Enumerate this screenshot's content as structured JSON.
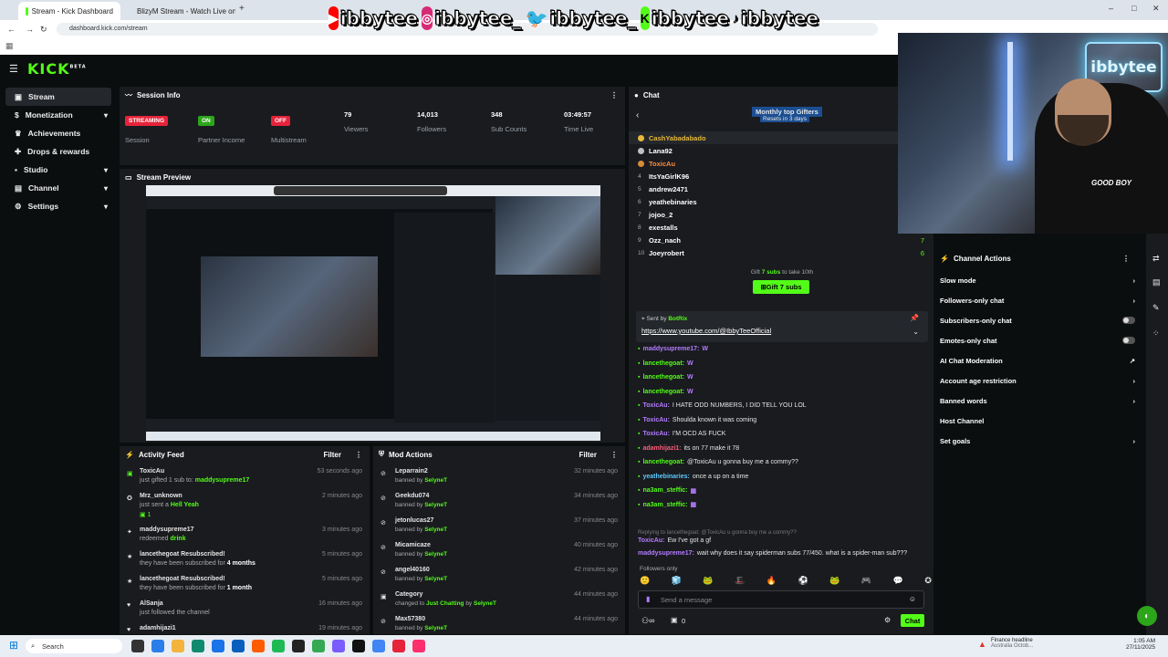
{
  "browser": {
    "tabs": [
      {
        "label": "Stream - Kick Dashboard"
      },
      {
        "label": "BlizyM Stream - Watch Live on..."
      }
    ],
    "new_tab": "+",
    "url": "dashboard.kick.com/stream"
  },
  "banner": {
    "handles": [
      "ibbytee",
      "ibbytee_",
      "ibbytee_",
      "ibbytee",
      "ibbytee"
    ]
  },
  "app": {
    "logo": "KICK",
    "logo_sup": "BETA"
  },
  "sidebar": {
    "items": [
      {
        "label": "Stream",
        "icon": "stream-icon"
      },
      {
        "label": "Monetization",
        "icon": "dollar-icon",
        "chev": "▾"
      },
      {
        "label": "Achievements",
        "icon": "trophy-icon"
      },
      {
        "label": "Drops & rewards",
        "icon": "gift-icon"
      },
      {
        "label": "Studio",
        "icon": "camera-icon",
        "chev": "▾"
      },
      {
        "label": "Channel",
        "icon": "channel-icon",
        "chev": "▾"
      },
      {
        "label": "Settings",
        "icon": "gear-icon",
        "chev": "▾"
      }
    ]
  },
  "session": {
    "title": "Session Info",
    "stats": [
      {
        "value": "STREAMING",
        "label": "Session",
        "color": "#e5233a"
      },
      {
        "value": "ON",
        "label": "Partner Income",
        "color": "#2ca51b"
      },
      {
        "value": "OFF",
        "label": "Multistream",
        "color": "#e5233a"
      },
      {
        "value": "79",
        "label": "Viewers"
      },
      {
        "value": "14,013",
        "label": "Followers"
      },
      {
        "value": "348",
        "label": "Sub Counts"
      },
      {
        "value": "03:49:57",
        "label": "Time Live"
      }
    ]
  },
  "preview": {
    "title": "Stream Preview"
  },
  "activity": {
    "title": "Activity Feed",
    "filter": "Filter",
    "items": [
      {
        "user": "ToxicAu",
        "text": "just gifted 1 sub to:",
        "target": "maddysupreme17",
        "time": "53 seconds ago"
      },
      {
        "user": "Mrz_unknown",
        "text": "just sent a",
        "target": "Hell Yeah",
        "extra": "1",
        "time": "2 minutes ago"
      },
      {
        "user": "maddysupreme17",
        "text": "redeemed",
        "target": "drink",
        "time": "3 minutes ago"
      },
      {
        "user": "lancethegoat Resubscribed!",
        "text": "they have been subscribed for",
        "target": "4 months",
        "time": "5 minutes ago"
      },
      {
        "user": "lancethegoat Resubscribed!",
        "text": "they have been subscribed for",
        "target": "1 month",
        "time": "5 minutes ago"
      },
      {
        "user": "AlSanja",
        "text": "just followed the channel",
        "target": "",
        "time": "16 minutes ago"
      },
      {
        "user": "adamhijazi1",
        "text": "",
        "target": "",
        "time": "19 minutes ago"
      }
    ]
  },
  "mod": {
    "title": "Mod Actions",
    "filter": "Filter",
    "items": [
      {
        "user": "Leparrain2",
        "action": "banned by",
        "by": "SelyneT",
        "time": "32 minutes ago"
      },
      {
        "user": "Geekdu074",
        "action": "banned by",
        "by": "SelyneT",
        "time": "34 minutes ago"
      },
      {
        "user": "jetonlucas27",
        "action": "banned by",
        "by": "SelyneT",
        "time": "37 minutes ago"
      },
      {
        "user": "Micamicaze",
        "action": "banned by",
        "by": "SelyneT",
        "time": "40 minutes ago"
      },
      {
        "user": "angel40160",
        "action": "banned by",
        "by": "SelyneT",
        "time": "42 minutes ago"
      },
      {
        "user": "Category",
        "action": "changed to",
        "by": "Just Chatting",
        "by2": "SelyneT",
        "time": "44 minutes ago"
      },
      {
        "user": "Max57380",
        "action": "banned by",
        "by": "SelyneT",
        "time": "44 minutes ago"
      }
    ]
  },
  "chat": {
    "title": "Chat",
    "gifters_title": "Monthly top Gifters",
    "gifters_sub": "Resets in 3 days",
    "gifters": [
      {
        "rank": "1",
        "name": "CashYabadabado"
      },
      {
        "rank": "2",
        "name": "Lana92"
      },
      {
        "rank": "3",
        "name": "ToxicAu"
      },
      {
        "rank": "4",
        "name": "ItsYaGirlK96"
      },
      {
        "rank": "5",
        "name": "andrew2471"
      },
      {
        "rank": "6",
        "name": "yeathebinaries"
      },
      {
        "rank": "7",
        "name": "jojoo_2"
      },
      {
        "rank": "8",
        "name": "exestalls"
      },
      {
        "rank": "9",
        "name": "Ozz_nach",
        "count": "7"
      },
      {
        "rank": "10",
        "name": "Joeyrobert",
        "count": "6"
      }
    ],
    "gift_line_a": "Gift",
    "gift_line_n": "7 subs",
    "gift_line_b": "to take 10th",
    "gift_button": "Gift 7 subs",
    "pinned_by": "Sent by",
    "pinned_user": "BotRix",
    "pinned_link": "https://www.youtube.com/@IbbyTeeOfficial",
    "messages": [
      {
        "user": "maddysupreme17:",
        "cls": "u-p",
        "text": ""
      },
      {
        "user": "lancethegoat:",
        "cls": "u-g",
        "text": ""
      },
      {
        "user": "lancethegoat:",
        "cls": "u-g",
        "text": ""
      },
      {
        "user": "lancethegoat:",
        "cls": "u-g",
        "text": ""
      },
      {
        "user": "ToxicAu:",
        "cls": "u-p",
        "text": "I HATE ODD NUMBERS, I DID TELL YOU LOL"
      },
      {
        "user": "ToxicAu:",
        "cls": "u-p",
        "text": "Shoulda known it was coming"
      },
      {
        "user": "ToxicAu:",
        "cls": "u-p",
        "text": "I'M OCD AS FUCK"
      },
      {
        "user": "adamhijazi1:",
        "cls": "u-r",
        "text": "its on 77 make it 78"
      },
      {
        "user": "lancethegoat:",
        "cls": "u-g",
        "text": "@ToxicAu u gonna buy me a commy??"
      },
      {
        "user": "yeathebinaries:",
        "cls": "u-b",
        "text": "once a up on a time"
      },
      {
        "user": "na3am_steffic:",
        "cls": "u-g",
        "text": ""
      },
      {
        "user": "na3am_steffic:",
        "cls": "u-g",
        "text": ""
      }
    ],
    "reply_to": "Replying to lancethegoat: @ToxicAu u gonna buy me a commy??",
    "reply_msg_user": "ToxicAu:",
    "reply_msg": "Ew I've got a gf",
    "last_user": "maddysupreme17:",
    "last_msg": "wait why does it say spiderman subs 77/450. what is a spider-man sub???",
    "followers_only": "Followers only",
    "placeholder": "Send a message",
    "count": "0",
    "send": "Chat"
  },
  "webcam": {
    "sign": "ibbytee",
    "shirt": "GOOD BOY"
  },
  "channel_actions": {
    "title": "Channel Actions",
    "items": [
      {
        "label": "Slow mode",
        "right": "›"
      },
      {
        "label": "Followers-only chat",
        "right": "›"
      },
      {
        "label": "Subscribers-only chat",
        "right": "toggle"
      },
      {
        "label": "Emotes-only chat",
        "right": "toggle"
      },
      {
        "label": "AI Chat Moderation",
        "right": "↗"
      },
      {
        "label": "Account age restriction",
        "right": "›"
      },
      {
        "label": "Banned words",
        "right": "›"
      },
      {
        "label": "Host Channel",
        "right": ""
      },
      {
        "label": "Set goals",
        "right": "›"
      }
    ]
  },
  "taskbar": {
    "search": "Search",
    "news": "Finance headline",
    "news2": "Australia Octob...",
    "time": "1:05 AM",
    "date": "27/11/2025"
  }
}
